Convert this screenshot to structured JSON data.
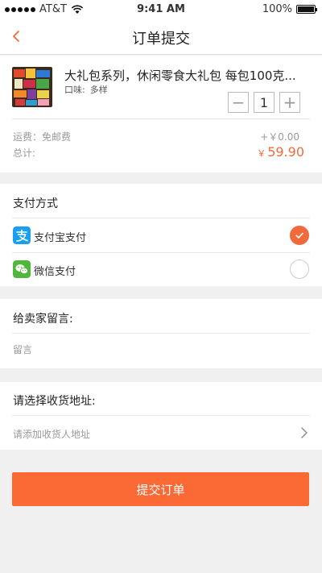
{
  "status_bar": {
    "carrier": "AT&T",
    "time": "9:41 AM",
    "battery": "100%"
  },
  "nav": {
    "back_icon": "chevron-left-icon",
    "title": "订单提交"
  },
  "product": {
    "name": "大礼包系列，休闲零食大礼包   每包100克...",
    "flavor_label": "口味:",
    "flavor_value": "多样",
    "quantity": "1",
    "minus": "−",
    "plus": "+"
  },
  "summary": {
    "shipping_label": "运费：免邮费",
    "shipping_value": "+￥0.00",
    "total_label": "总计:",
    "total_currency": "￥",
    "total_amount": "59.90"
  },
  "payment": {
    "title": "支付方式",
    "options": [
      {
        "label": "支付宝支付",
        "icon": "alipay-icon",
        "selected": true
      },
      {
        "label": "微信支付",
        "icon": "wechat-icon",
        "selected": false
      }
    ]
  },
  "message": {
    "title": "给卖家留言:",
    "placeholder": "留言"
  },
  "address": {
    "title": "请选择收货地址:",
    "prompt": "请添加收货人地址"
  },
  "submit": {
    "label": "提交订单"
  },
  "colors": {
    "accent": "#f26b3a",
    "alipay": "#1a9ff0",
    "wechat": "#4fb73c",
    "background": "#f0f0f0"
  }
}
